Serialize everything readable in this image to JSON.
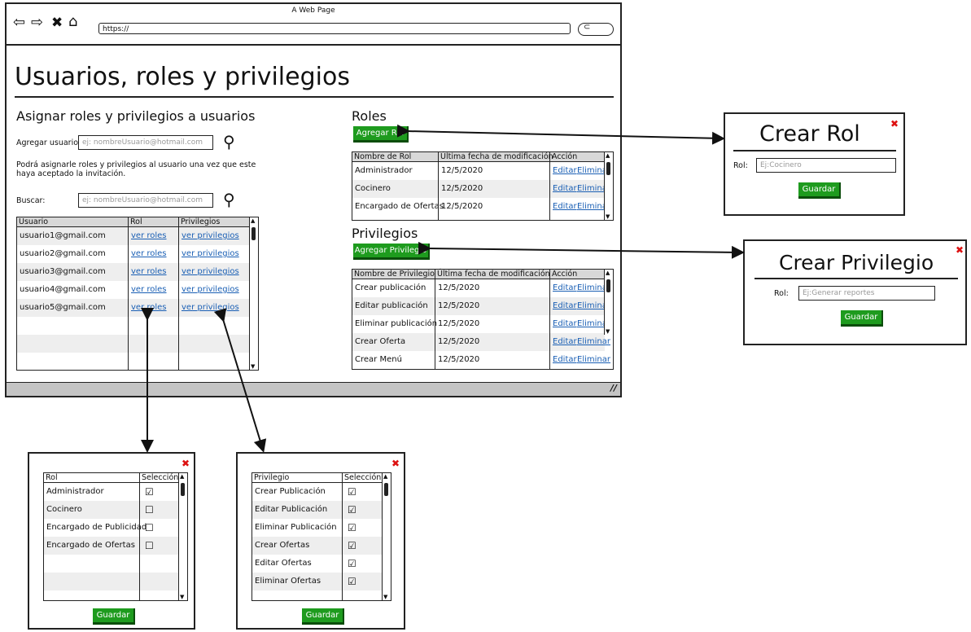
{
  "browser": {
    "window_title": "A Web Page",
    "url": "https://"
  },
  "page": {
    "title": "Usuarios, roles y privilegios",
    "assign_section": {
      "heading": "Asignar roles y privilegios a usuarios",
      "add_user_label": "Agregar usuario",
      "add_user_placeholder": "ej: nombreUsuario@hotmail.com",
      "note": "Podrá asignarle roles y privilegios al usuario una vez que este haya aceptado la invitación.",
      "search_label": "Buscar:",
      "search_placeholder": "ej: nombreUsuario@hotmail.com",
      "table": {
        "headers": [
          "Usuario",
          "Rol",
          "Privilegios"
        ],
        "rows": [
          {
            "user": "usuario1@gmail.com",
            "role": "ver roles",
            "priv": "ver privilegios"
          },
          {
            "user": "usuario2@gmail.com",
            "role": "ver roles",
            "priv": "ver privilegios"
          },
          {
            "user": "usuario3@gmail.com",
            "role": "ver roles",
            "priv": "ver privilegios"
          },
          {
            "user": "usuario4@gmail.com",
            "role": "ver roles",
            "priv": "ver privilegios"
          },
          {
            "user": "usuario5@gmail.com",
            "role": "ver roles",
            "priv": "ver privilegios"
          }
        ]
      }
    },
    "roles_section": {
      "heading": "Roles",
      "add_button": "Agregar Rol",
      "table": {
        "headers": [
          "Nombre de Rol",
          "Última fecha de modificación",
          "Acción"
        ],
        "rows": [
          {
            "name": "Administrador",
            "date": "12/5/2020",
            "edit": "Editar",
            "delete": "Eliminar"
          },
          {
            "name": "Cocinero",
            "date": "12/5/2020",
            "edit": "Editar",
            "delete": "Eliminar"
          },
          {
            "name": "Encargado de Ofertas",
            "date": "12/5/2020",
            "edit": "Editar",
            "delete": "Eliminar"
          }
        ]
      }
    },
    "privileges_section": {
      "heading": "Privilegios",
      "add_button": "Agregar Privilegio",
      "table": {
        "headers": [
          "Nombre de Privilegio",
          "Última fecha de modificación",
          "Acción"
        ],
        "rows": [
          {
            "name": "Crear publicación",
            "date": "12/5/2020",
            "edit": "Editar",
            "delete": "Eliminar"
          },
          {
            "name": "Editar publicación",
            "date": "12/5/2020",
            "edit": "Editar",
            "delete": "Eliminar"
          },
          {
            "name": "Eliminar publicación",
            "date": "12/5/2020",
            "edit": "Editar",
            "delete": "Eliminar"
          },
          {
            "name": "Crear Oferta",
            "date": "12/5/2020",
            "edit": "Editar",
            "delete": "Eliminar"
          },
          {
            "name": "Crear Menú",
            "date": "12/5/2020",
            "edit": "Editar",
            "delete": "Eliminar"
          }
        ]
      }
    }
  },
  "dialog_create_role": {
    "title": "Crear Rol",
    "field_label": "Rol:",
    "placeholder": "Ej:Cocinero",
    "save": "Guardar"
  },
  "dialog_create_privilege": {
    "title": "Crear Privilegio",
    "field_label": "Rol:",
    "placeholder": "Ej:Generar reportes",
    "save": "Guardar"
  },
  "dialog_roles": {
    "headers": [
      "Rol",
      "Selección"
    ],
    "rows": [
      {
        "name": "Administrador",
        "checked": true
      },
      {
        "name": "Cocinero",
        "checked": false
      },
      {
        "name": "Encargado de Publicidad",
        "checked": false
      },
      {
        "name": "Encargado de Ofertas",
        "checked": false
      }
    ],
    "save": "Guardar"
  },
  "dialog_privileges": {
    "headers": [
      "Privilegio",
      "Selección"
    ],
    "rows": [
      {
        "name": "Crear Publicación",
        "checked": true
      },
      {
        "name": "Editar Publicación",
        "checked": true
      },
      {
        "name": "Eliminar Publicación",
        "checked": true
      },
      {
        "name": "Crear Ofertas",
        "checked": true
      },
      {
        "name": "Editar Ofertas",
        "checked": true
      },
      {
        "name": "Eliminar Ofertas",
        "checked": true
      }
    ],
    "save": "Guardar"
  },
  "colors": {
    "button": "#1e9b1e",
    "link": "#1a5fb4",
    "close": "#dd1111"
  }
}
